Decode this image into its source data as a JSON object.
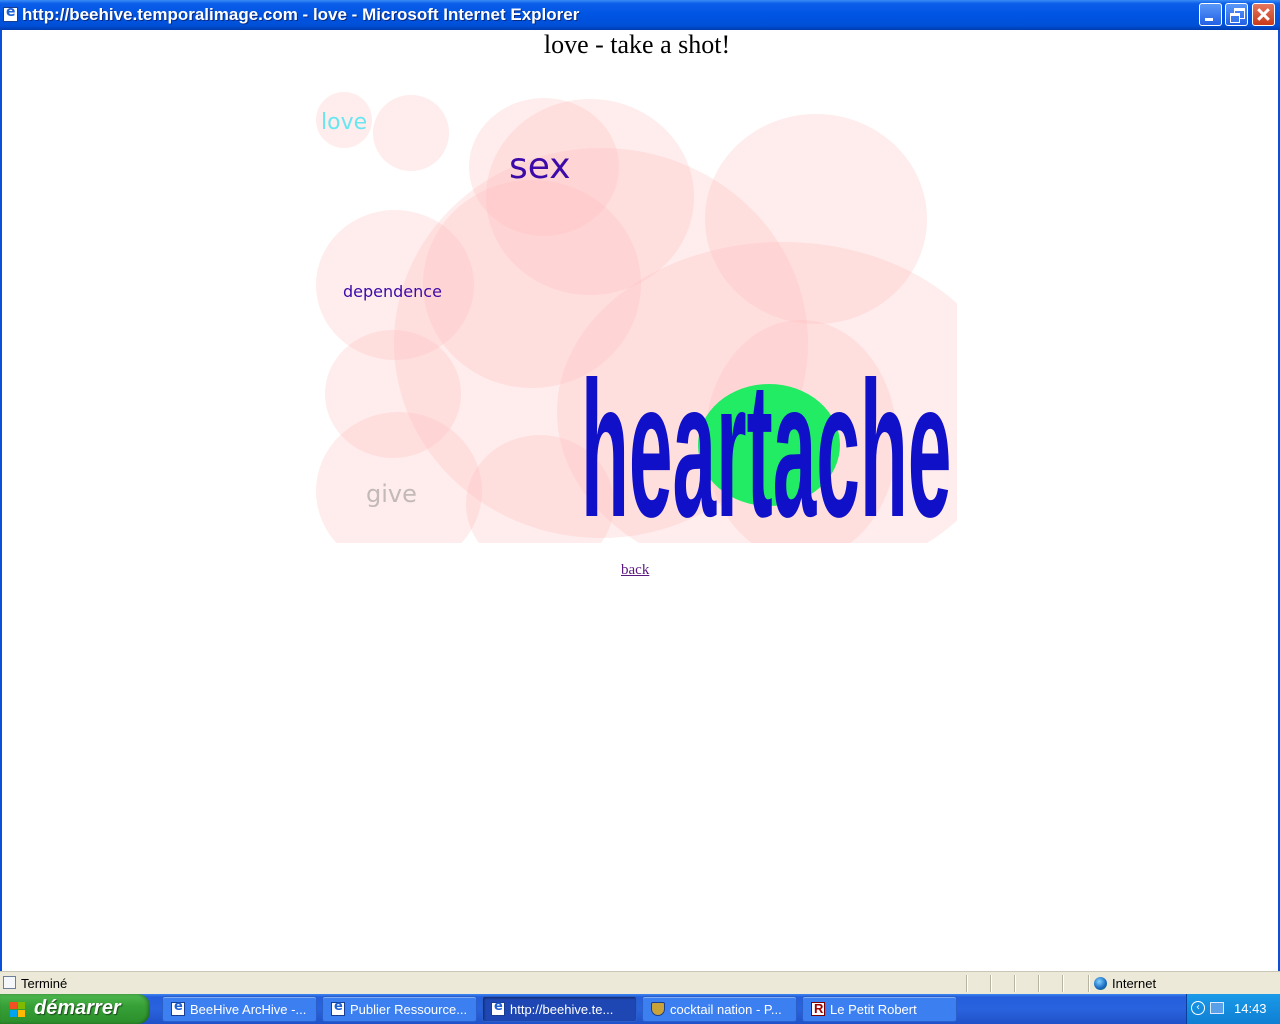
{
  "window": {
    "title": "http://beehive.temporalimage.com - love - Microsoft Internet Explorer"
  },
  "page": {
    "heading": "love - take a shot!",
    "words": {
      "love": "love",
      "sex": "sex",
      "dependence": "dependence",
      "give": "give",
      "heartache": "heartache"
    },
    "back_link": "back"
  },
  "statusbar": {
    "status": "Terminé",
    "zone": "Internet"
  },
  "taskbar": {
    "start_label": "démarrer",
    "items": [
      {
        "label": "BeeHive ArcHive -...",
        "icon": "ie-icon",
        "active": false
      },
      {
        "label": "Publier Ressource...",
        "icon": "ie-icon",
        "active": false
      },
      {
        "label": "http://beehive.te...",
        "icon": "ie-icon",
        "active": true
      },
      {
        "label": "cocktail nation - P...",
        "icon": "cocktail-icon",
        "active": false
      },
      {
        "label": "Le Petit Robert",
        "icon": "robert-icon",
        "active": false
      }
    ],
    "clock": "14:43"
  },
  "colors": {
    "titlebar_blue": "#0054e3",
    "circle_pink": "#ffb9b9",
    "highlight_green": "#22ec64",
    "word_dark_purple": "#3c0aa8",
    "word_blue": "#1010c8",
    "word_cyan": "#6ae6f0",
    "word_grey": "#c3b9b9",
    "taskbar_blue": "#245edb",
    "start_green": "#37a037"
  }
}
